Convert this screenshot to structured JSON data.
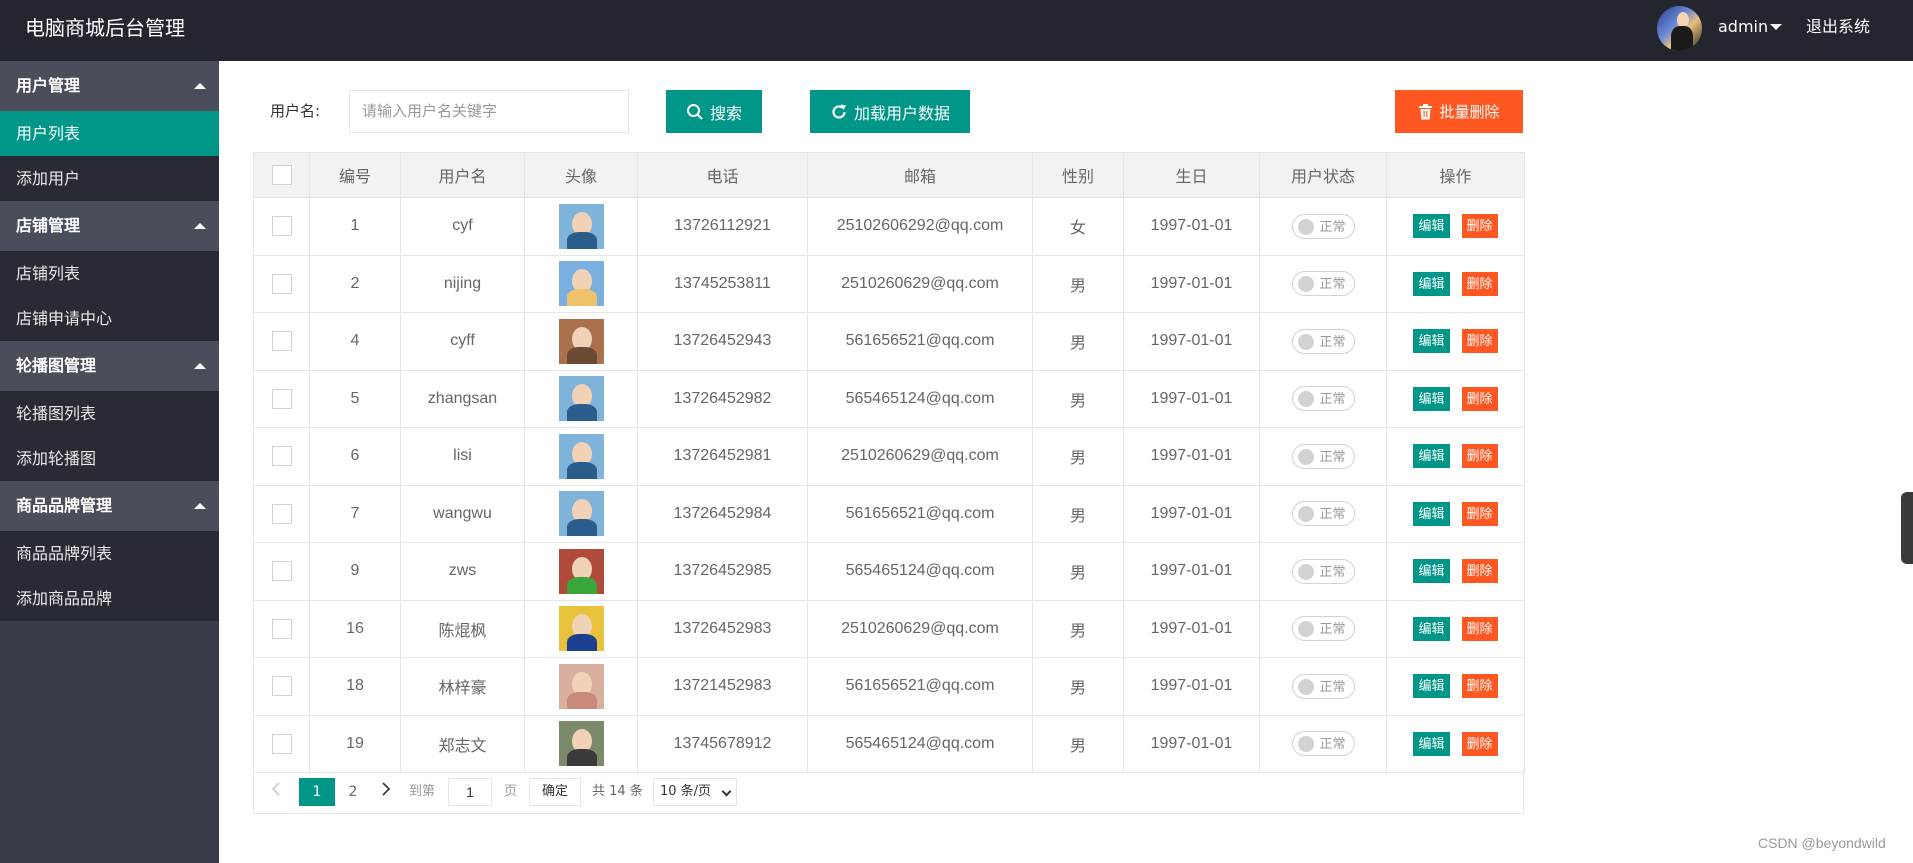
{
  "app": {
    "title": "电脑商城后台管理",
    "user": "admin",
    "logout": "退出系统"
  },
  "sidebar": {
    "groups": [
      {
        "label": "用户管理",
        "items": [
          "用户列表",
          "添加用户"
        ]
      },
      {
        "label": "店铺管理",
        "items": [
          "店铺列表",
          "店铺申请中心"
        ]
      },
      {
        "label": "轮播图管理",
        "items": [
          "轮播图列表",
          "添加轮播图"
        ]
      },
      {
        "label": "商品品牌管理",
        "items": [
          "商品品牌列表",
          "添加商品品牌"
        ]
      }
    ],
    "active": "用户列表"
  },
  "toolbar": {
    "username_label": "用户名:",
    "search_placeholder": "请输入用户名关键字",
    "search_button": "搜索",
    "load_button": "加载用户数据",
    "batch_delete_button": "批量删除"
  },
  "table": {
    "headers": [
      "编号",
      "用户名",
      "头像",
      "电话",
      "邮箱",
      "性别",
      "生日",
      "用户状态",
      "操作"
    ],
    "rows": [
      {
        "id": "1",
        "username": "cyf",
        "phone": "13726112921",
        "email": "2510260629​2@qq.com",
        "gender": "女",
        "birthday": "1997-01-01",
        "status": "正常",
        "avatar_colors": [
          "#2a5d8c",
          "#7fb3d9"
        ]
      },
      {
        "id": "2",
        "username": "nijing",
        "phone": "13745253811",
        "email": "2510260629@qq.com",
        "gender": "男",
        "birthday": "1997-01-01",
        "status": "正常",
        "avatar_colors": [
          "#f0c36a",
          "#7ab0e0"
        ]
      },
      {
        "id": "4",
        "username": "cyff",
        "phone": "13726452943",
        "email": "561656521@qq.com",
        "gender": "男",
        "birthday": "1997-01-01",
        "status": "正常",
        "avatar_colors": [
          "#6b4a36",
          "#a9714c"
        ]
      },
      {
        "id": "5",
        "username": "zhangsan",
        "phone": "13726452982",
        "email": "565465124@qq.com",
        "gender": "男",
        "birthday": "1997-01-01",
        "status": "正常",
        "avatar_colors": [
          "#2a5d8c",
          "#7fb3d9"
        ]
      },
      {
        "id": "6",
        "username": "lisi",
        "phone": "13726452981",
        "email": "2510260629@qq.com",
        "gender": "男",
        "birthday": "1997-01-01",
        "status": "正常",
        "avatar_colors": [
          "#2a5d8c",
          "#7fb3d9"
        ]
      },
      {
        "id": "7",
        "username": "wangwu",
        "phone": "13726452984",
        "email": "561656521@qq.com",
        "gender": "男",
        "birthday": "1997-01-01",
        "status": "正常",
        "avatar_colors": [
          "#2a5d8c",
          "#7fb3d9"
        ]
      },
      {
        "id": "9",
        "username": "zws",
        "phone": "13726452985",
        "email": "565465124@qq.com",
        "gender": "男",
        "birthday": "1997-01-01",
        "status": "正常",
        "avatar_colors": [
          "#3aa63a",
          "#b04a3a"
        ]
      },
      {
        "id": "16",
        "username": "陈焜枫",
        "phone": "13726452983",
        "email": "2510260629@qq.com",
        "gender": "男",
        "birthday": "1997-01-01",
        "status": "正常",
        "avatar_colors": [
          "#1d3f8f",
          "#e8c23a"
        ]
      },
      {
        "id": "18",
        "username": "林梓豪",
        "phone": "13721452983",
        "email": "561656521@qq.com",
        "gender": "男",
        "birthday": "1997-01-01",
        "status": "正常",
        "avatar_colors": [
          "#c98a7a",
          "#d9b0a0"
        ]
      },
      {
        "id": "19",
        "username": "郑志文",
        "phone": "13745678912",
        "email": "565465124@qq.com",
        "gender": "男",
        "birthday": "1997-01-01",
        "status": "正常",
        "avatar_colors": [
          "#3a3a3a",
          "#7a8a6a"
        ]
      }
    ],
    "actions": {
      "edit": "编辑",
      "delete": "删除"
    }
  },
  "pager": {
    "current": "1",
    "page2": "2",
    "goto_label": "到第",
    "goto_value": "1",
    "page_label": "页",
    "confirm": "确定",
    "total": "共 14 条",
    "page_size": "10 条/页"
  },
  "watermark": "CSDN @beyondwild",
  "colors": {
    "header": "#23262e",
    "sidebar": "#393d49",
    "accent": "#009688",
    "danger": "#ff5722"
  }
}
